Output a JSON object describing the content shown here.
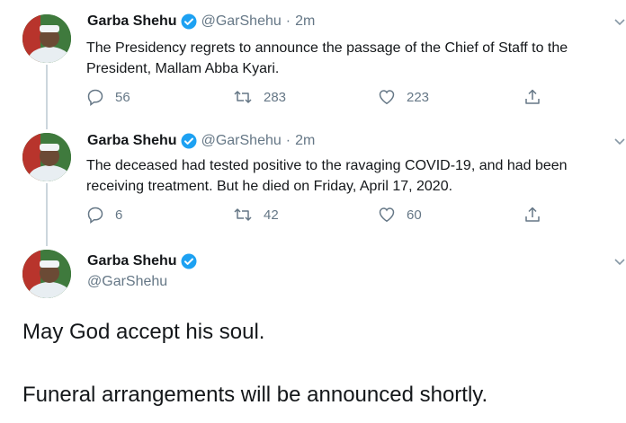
{
  "author": {
    "name": "Garba Shehu",
    "handle": "@GarShehu"
  },
  "colors": {
    "verified": "#1da1f2",
    "secondary_text": "#657786",
    "thread_line": "#ccd6dd"
  },
  "tweets": [
    {
      "time": "2m",
      "text": "The Presidency regrets to announce the passage of the Chief of Staff to the President, Mallam Abba Kyari.",
      "replies": "56",
      "retweets": "283",
      "likes": "223"
    },
    {
      "time": "2m",
      "text": "The deceased had tested positive to the ravaging COVID-19, and had been receiving treatment. But he died on Friday, April 17, 2020.",
      "replies": "6",
      "retweets": "42",
      "likes": "60"
    }
  ],
  "main_tweet": {
    "line1": "May God accept his soul.",
    "line2": "Funeral arrangements will be announced shortly."
  },
  "icons": {
    "reply": "reply-icon",
    "retweet": "retweet-icon",
    "like": "heart-icon",
    "share": "share-icon",
    "verified": "verified-badge-icon",
    "more": "chevron-down-icon"
  }
}
